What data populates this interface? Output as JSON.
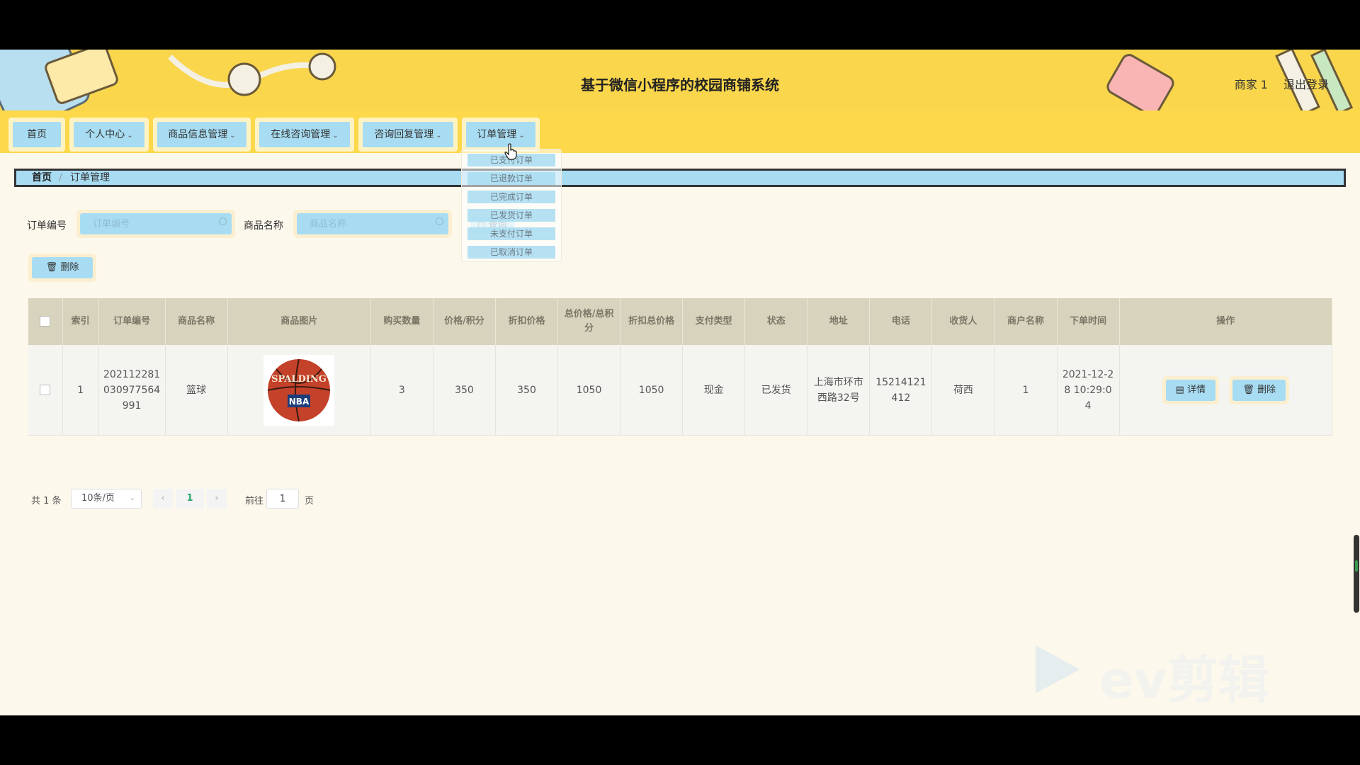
{
  "header": {
    "title": "基于微信小程序的校园商铺系统",
    "user": "商家 1",
    "logout": "退出登录"
  },
  "nav": {
    "items": [
      {
        "label": "首页",
        "has_dropdown": false
      },
      {
        "label": "个人中心",
        "has_dropdown": true
      },
      {
        "label": "商品信息管理",
        "has_dropdown": true
      },
      {
        "label": "在线咨询管理",
        "has_dropdown": true
      },
      {
        "label": "咨询回复管理",
        "has_dropdown": true
      },
      {
        "label": "订单管理",
        "has_dropdown": true
      }
    ],
    "order_submenu": [
      "已支付订单",
      "已退款订单",
      "已完成订单",
      "已发货订单",
      "未支付订单",
      "已取消订单"
    ]
  },
  "breadcrumb": {
    "home": "首页",
    "separator": "/",
    "current": "订单管理"
  },
  "search": {
    "order_no_label": "订单编号",
    "order_no_placeholder": "订单编号",
    "product_name_label": "商品名称",
    "product_name_placeholder": "商品名称",
    "query_button": "查询"
  },
  "actions": {
    "batch_delete": "删除"
  },
  "table": {
    "columns": [
      "索引",
      "订单编号",
      "商品名称",
      "商品图片",
      "购买数量",
      "价格/积分",
      "折扣价格",
      "总价格/总积分",
      "折扣总价格",
      "支付类型",
      "状态",
      "地址",
      "电话",
      "收货人",
      "商户名称",
      "下单时间",
      "操作"
    ],
    "rows": [
      {
        "index": "1",
        "order_no": "202112281030977564991",
        "product_name": "篮球",
        "image_text_top": "SPALDING",
        "image_text_bottom": "NBA",
        "quantity": "3",
        "price": "350",
        "discount_price": "350",
        "total_price": "1050",
        "discount_total": "1050",
        "pay_type": "现金",
        "status": "已发货",
        "address": "上海市环市西路32号",
        "phone": "15214121412",
        "receiver": "荷西",
        "merchant": "1",
        "order_time": "2021-12-28 10:29:04",
        "detail_button": "详情",
        "delete_button": "删除"
      }
    ]
  },
  "pagination": {
    "total": "共 1 条",
    "page_size": "10条/页",
    "current_page": "1",
    "goto_prefix": "前往",
    "goto_value": "1",
    "goto_suffix": "页"
  },
  "watermark": {
    "text": "ev剪辑"
  },
  "colors": {
    "header_bg": "#f9d64c",
    "button_blue": "#a8dcf2",
    "button_frame": "#fbefd0",
    "page_bg": "#fdf8ec",
    "table_header": "#d8d3bd",
    "accent_green": "#2ca76b"
  }
}
